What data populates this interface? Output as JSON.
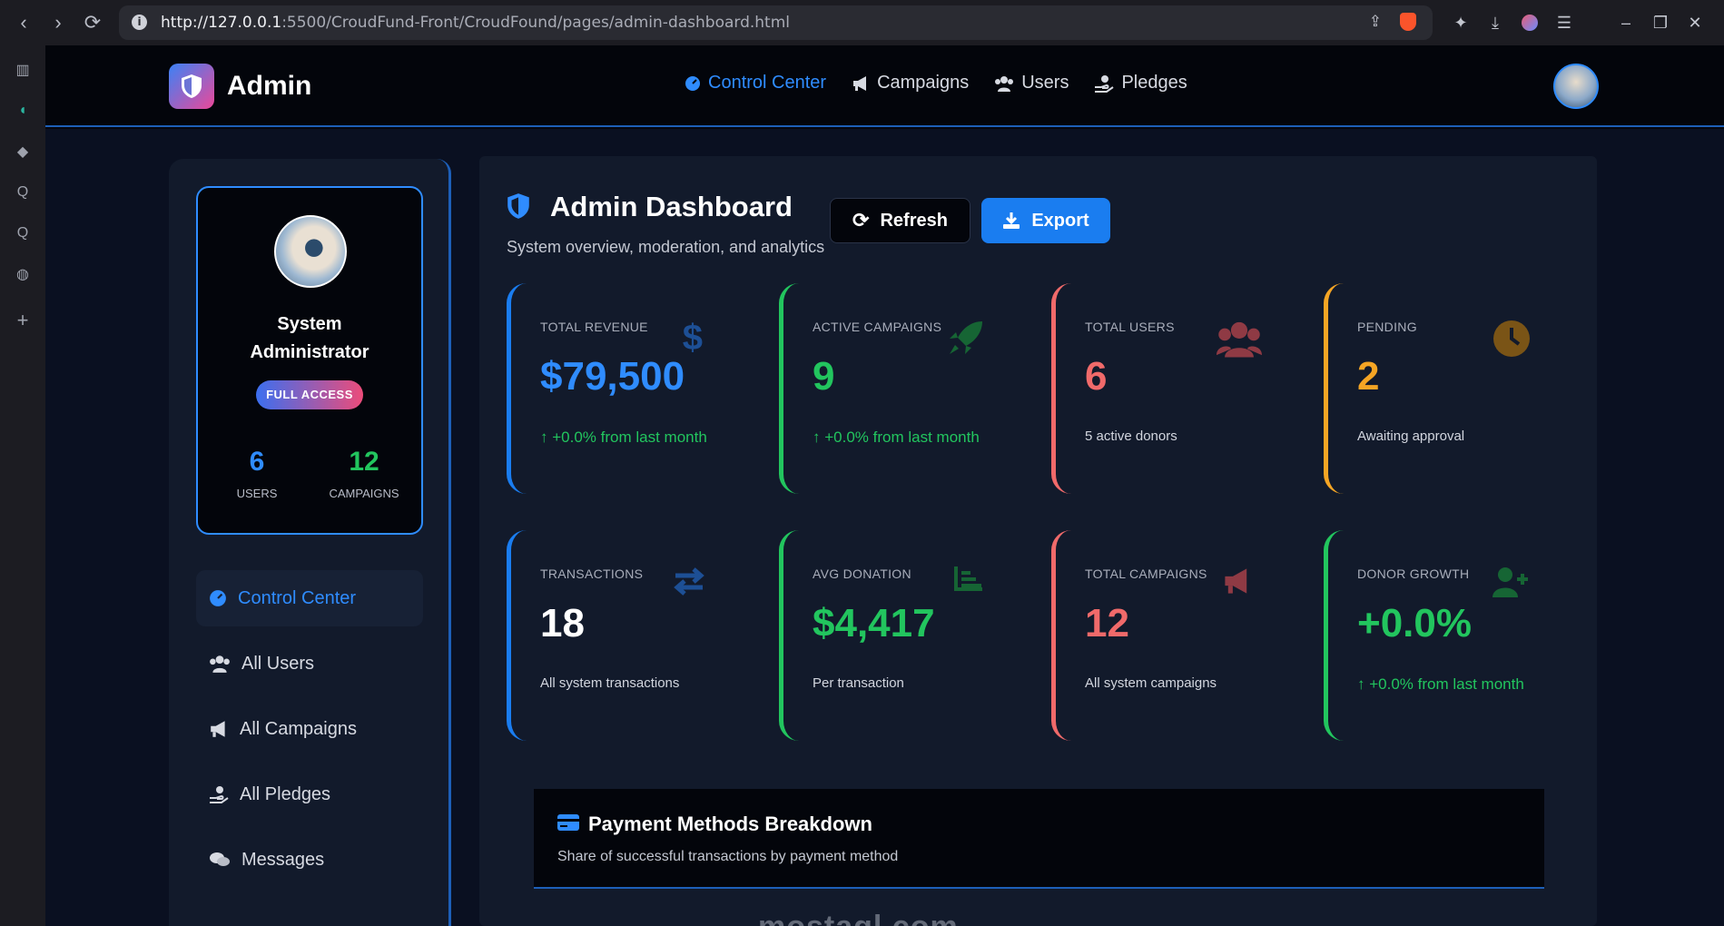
{
  "browser": {
    "url_host": "http://127.0.0.1",
    "url_path": ":5500/CroudFund-Front/CroudFound/pages/admin-dashboard.html"
  },
  "topnav": {
    "brand": "Admin",
    "links": [
      {
        "label": "Control Center",
        "icon": "dashboard-icon",
        "active": true
      },
      {
        "label": "Campaigns",
        "icon": "megaphone-icon"
      },
      {
        "label": "Users",
        "icon": "users-icon"
      },
      {
        "label": "Pledges",
        "icon": "hand-coin-icon"
      }
    ]
  },
  "profile": {
    "name_line1": "System",
    "name_line2": "Administrator",
    "badge": "FULL ACCESS",
    "stats": [
      {
        "value": "6",
        "label": "USERS",
        "color": "#2f8cff"
      },
      {
        "value": "12",
        "label": "CAMPAIGNS",
        "color": "#22c55e"
      }
    ]
  },
  "sidebar_menu": [
    {
      "label": "Control Center",
      "icon": "dashboard-icon",
      "active": true
    },
    {
      "label": "All Users",
      "icon": "users-icon"
    },
    {
      "label": "All Campaigns",
      "icon": "megaphone-icon"
    },
    {
      "label": "All Pledges",
      "icon": "hand-coin-icon"
    },
    {
      "label": "Messages",
      "icon": "chat-icon"
    }
  ],
  "header": {
    "title": "Admin Dashboard",
    "subtitle": "System overview, moderation, and analytics",
    "refresh_label": "Refresh",
    "export_label": "Export"
  },
  "cards": [
    {
      "label": "TOTAL REVENUE",
      "value": "$79,500",
      "note": "+0.0% from last month",
      "accent": "#1a7df0",
      "value_color": "#2f8cff",
      "icon": "dollar-icon"
    },
    {
      "label": "ACTIVE CAMPAIGNS",
      "value": "9",
      "note": "+0.0% from last month",
      "accent": "#22c55e",
      "value_color": "#22c55e",
      "icon": "rocket-icon"
    },
    {
      "label": "TOTAL USERS",
      "value": "6",
      "note": "5 active donors",
      "accent": "#f06a6a",
      "value_color": "#f06a6a",
      "icon": "users-icon"
    },
    {
      "label": "PENDING",
      "value": "2",
      "note": "Awaiting approval",
      "accent": "#f5a524",
      "value_color": "#f5a524",
      "icon": "clock-icon"
    },
    {
      "label": "TRANSACTIONS",
      "value": "18",
      "note": "All system transactions",
      "accent": "#1a7df0",
      "value_color": "#ffffff",
      "icon": "exchange-icon"
    },
    {
      "label": "AVG DONATION",
      "value": "$4,417",
      "note": "Per transaction",
      "accent": "#22c55e",
      "value_color": "#22c55e",
      "icon": "chart-icon"
    },
    {
      "label": "TOTAL CAMPAIGNS",
      "value": "12",
      "note": "All system campaigns",
      "accent": "#f06a6a",
      "value_color": "#f06a6a",
      "icon": "megaphone-icon"
    },
    {
      "label": "DONOR GROWTH",
      "value": "+0.0%",
      "note": "+0.0% from last month",
      "accent": "#22c55e",
      "value_color": "#22c55e",
      "icon": "user-plus-icon"
    }
  ],
  "payment": {
    "title": "Payment Methods Breakdown",
    "subtitle": "Share of successful transactions by payment method"
  },
  "watermark": "mostaql.com"
}
